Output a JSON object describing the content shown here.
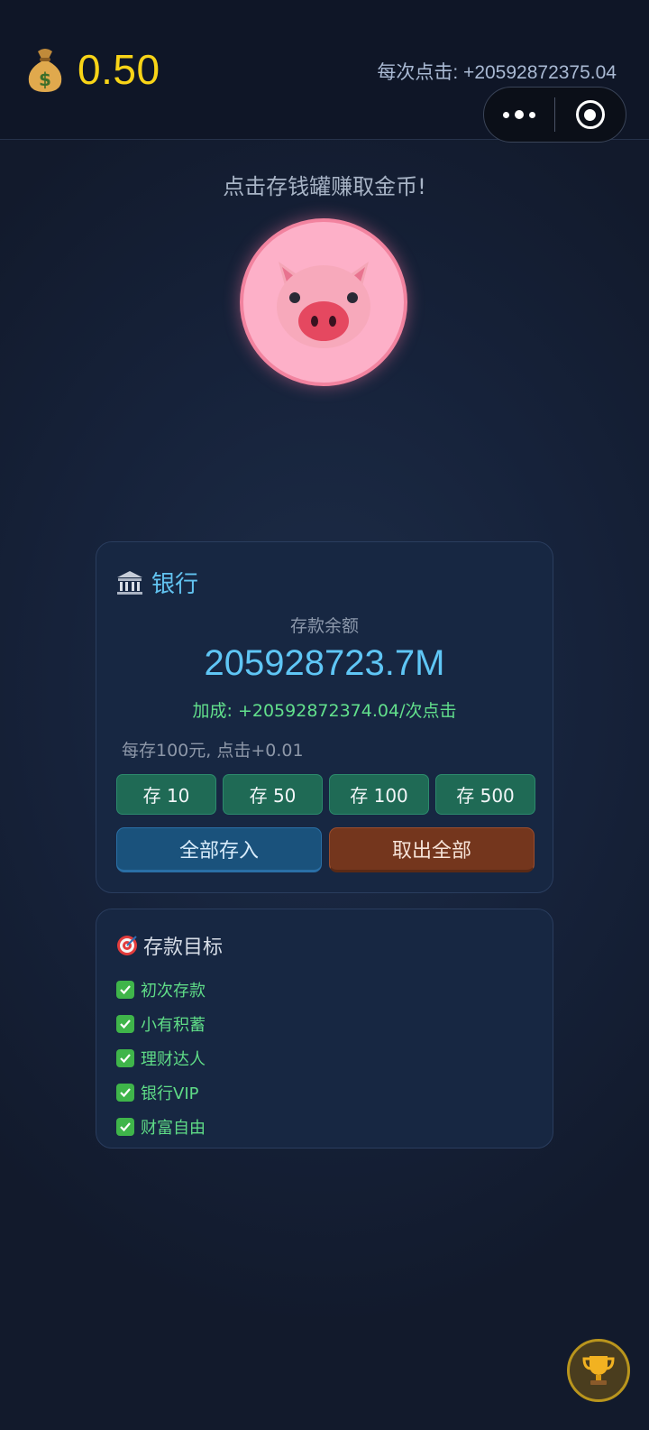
{
  "header": {
    "coin_icon": "money-bag-icon",
    "coins": "0.50",
    "per_click": "每次点击: +20592872375.04",
    "capsule_more_icon": "more-dots-icon",
    "capsule_close_icon": "record-circle-icon"
  },
  "main": {
    "hint": "点击存钱罐赚取金币!",
    "piggy_icon": "pig-face-icon"
  },
  "bank": {
    "icon": "bank-icon",
    "title": "银行",
    "balance_label": "存款余额",
    "balance": "205928723.7M",
    "bonus": "加成: +20592872374.04/次点击",
    "rule": "每存100元, 点击+0.01",
    "deposit_buttons": [
      "存 10",
      "存 50",
      "存 100",
      "存 500"
    ],
    "deposit_all": "全部存入",
    "withdraw_all": "取出全部"
  },
  "goals": {
    "icon": "target-icon",
    "title": "存款目标",
    "items": [
      "初次存款",
      "小有积蓄",
      "理财达人",
      "银行VIP",
      "财富自由"
    ]
  },
  "trophy_icon": "trophy-icon",
  "colors": {
    "coin": "#f8d417",
    "accent_blue": "#5fc6f5",
    "accent_green": "#62e08c",
    "pig_pink": "#fdb0c8",
    "deposit_btn": "#1f6a55",
    "withdraw_btn": "#74361d"
  }
}
